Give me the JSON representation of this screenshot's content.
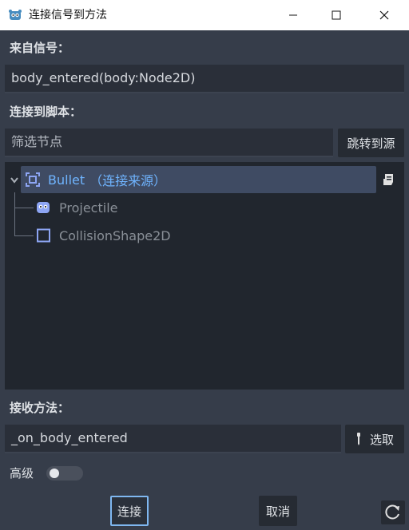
{
  "window": {
    "title": "连接信号到方法",
    "icon": "godot-icon",
    "controls": [
      "minimize-icon",
      "maximize-icon",
      "close-icon"
    ]
  },
  "signal_section": {
    "label": "来自信号：",
    "value": "body_entered(body:Node2D)"
  },
  "script_section": {
    "label": "连接到脚本：",
    "filter_placeholder": "筛选节点",
    "goto_source_label": "跳转到源"
  },
  "tree": {
    "items": [
      {
        "name": "Bullet",
        "suffix": "（连接来源）",
        "icon": "area2d-icon",
        "selected": true
      },
      {
        "name": "Projectile",
        "icon": "godot-head-icon",
        "selected": false
      },
      {
        "name": "CollisionShape2D",
        "icon": "collision-shape-icon",
        "selected": false
      }
    ]
  },
  "method_section": {
    "label": "接收方法：",
    "value": "_on_body_entered",
    "pick_label": "选取"
  },
  "advanced": {
    "label": "高级",
    "enabled": false
  },
  "footer": {
    "connect_label": "连接",
    "cancel_label": "取消"
  },
  "colors": {
    "background": "#363d4a",
    "panel": "#21262e",
    "field": "#2a2f39",
    "accent": "#6fb4ff",
    "selection": "#3f4b63",
    "focus_border": "#7fb7f0"
  }
}
